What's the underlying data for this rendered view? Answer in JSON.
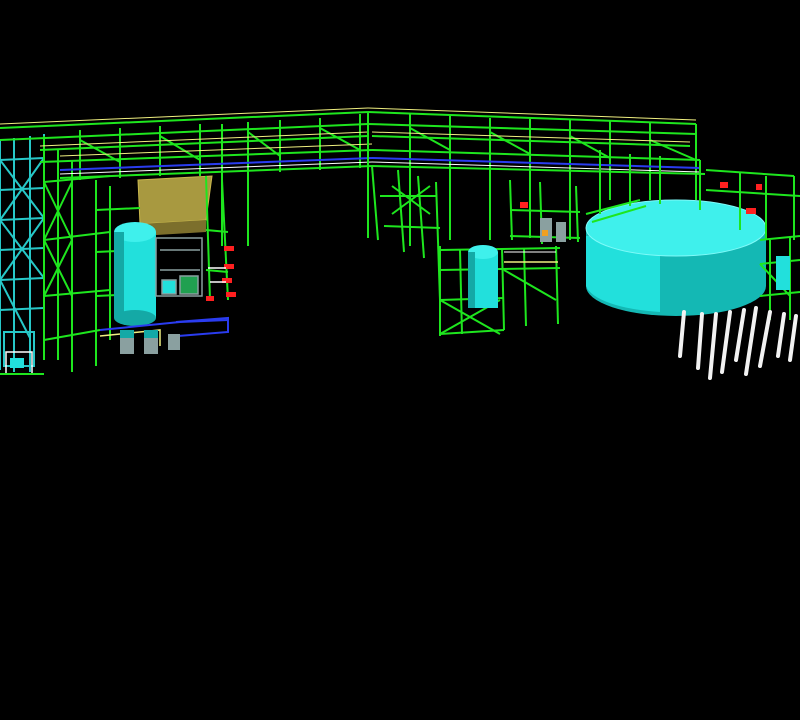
{
  "app": {
    "title": ""
  },
  "viewport": {
    "background": "#000000"
  },
  "colors": {
    "structure": "#1ee61e",
    "structure_dark": "#0fa20f",
    "tank": "#22e0dc",
    "tank_dark": "#14a9a6",
    "handrail": "#f0f080",
    "roof": "#a89940",
    "pipe_blue": "#2a3cf0",
    "valve_red": "#ff2020",
    "pile": "#f2f2f2",
    "steel_grey": "#8aa0a0",
    "cyan_frame": "#27c8c8"
  },
  "icons": [
    "plant-model-icon"
  ]
}
